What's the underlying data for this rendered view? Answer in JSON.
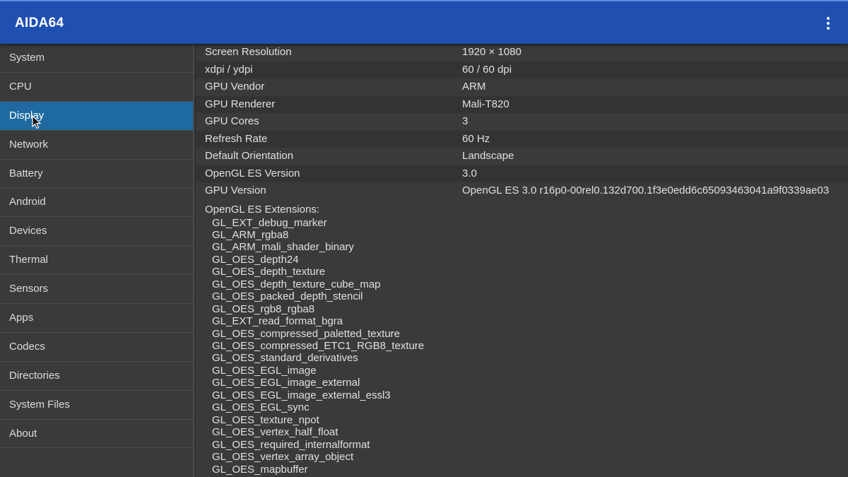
{
  "app": {
    "title": "AIDA64"
  },
  "sidebar": {
    "items": [
      {
        "label": "System"
      },
      {
        "label": "CPU"
      },
      {
        "label": "Display"
      },
      {
        "label": "Network"
      },
      {
        "label": "Battery"
      },
      {
        "label": "Android"
      },
      {
        "label": "Devices"
      },
      {
        "label": "Thermal"
      },
      {
        "label": "Sensors"
      },
      {
        "label": "Apps"
      },
      {
        "label": "Codecs"
      },
      {
        "label": "Directories"
      },
      {
        "label": "System Files"
      },
      {
        "label": "About"
      }
    ],
    "active": "Display"
  },
  "details": {
    "rows": [
      {
        "key": "Screen Resolution",
        "value": "1920 × 1080"
      },
      {
        "key": "xdpi / ydpi",
        "value": "60 / 60 dpi"
      },
      {
        "key": "GPU Vendor",
        "value": "ARM"
      },
      {
        "key": "GPU Renderer",
        "value": "Mali-T820"
      },
      {
        "key": "GPU Cores",
        "value": "3"
      },
      {
        "key": "Refresh Rate",
        "value": "60 Hz"
      },
      {
        "key": "Default Orientation",
        "value": "Landscape"
      },
      {
        "key": "OpenGL ES Version",
        "value": "3.0"
      },
      {
        "key": "GPU Version",
        "value": "OpenGL ES 3.0 r16p0-00rel0.132d700.1f3e0edd6c65093463041a9f0339ae03"
      }
    ],
    "extensions_header": "OpenGL ES Extensions:",
    "extensions": [
      "GL_EXT_debug_marker",
      "GL_ARM_rgba8",
      "GL_ARM_mali_shader_binary",
      "GL_OES_depth24",
      "GL_OES_depth_texture",
      "GL_OES_depth_texture_cube_map",
      "GL_OES_packed_depth_stencil",
      "GL_OES_rgb8_rgba8",
      "GL_EXT_read_format_bgra",
      "GL_OES_compressed_paletted_texture",
      "GL_OES_compressed_ETC1_RGB8_texture",
      "GL_OES_standard_derivatives",
      "GL_OES_EGL_image",
      "GL_OES_EGL_image_external",
      "GL_OES_EGL_image_external_essl3",
      "GL_OES_EGL_sync",
      "GL_OES_texture_npot",
      "GL_OES_vertex_half_float",
      "GL_OES_required_internalformat",
      "GL_OES_vertex_array_object",
      "GL_OES_mapbuffer"
    ]
  },
  "colors": {
    "appbar": "#1f4fb0",
    "active_item": "#1e6aa0",
    "background": "#2f2f2f"
  },
  "icons": {
    "menu": "more-vert-icon",
    "cursor": "mouse-pointer-icon"
  }
}
